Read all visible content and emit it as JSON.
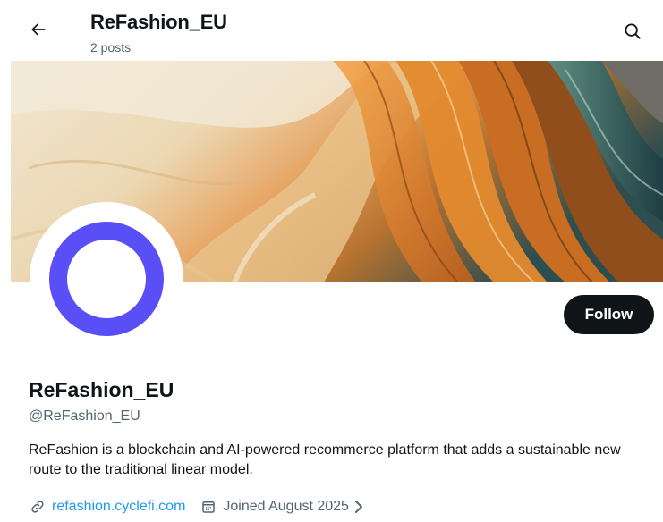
{
  "header": {
    "title": "ReFashion_EU",
    "post_count": "2 posts",
    "back_icon": "arrow-left-icon",
    "search_icon": "search-icon"
  },
  "profile": {
    "display_name": "ReFashion_EU",
    "handle": "@ReFashion_EU",
    "bio": "ReFashion is a blockchain and AI-powered recommerce platform that adds a sustainable new route to the traditional linear model.",
    "website": "refashion.cyclefi.com",
    "joined": "Joined August 2025",
    "follow_label": "Follow"
  },
  "colors": {
    "text": "#0f1419",
    "secondary": "#536471",
    "link": "#1d9bf0",
    "avatar_ring": "#5a4ff7",
    "follow_bg": "#0f1419"
  }
}
